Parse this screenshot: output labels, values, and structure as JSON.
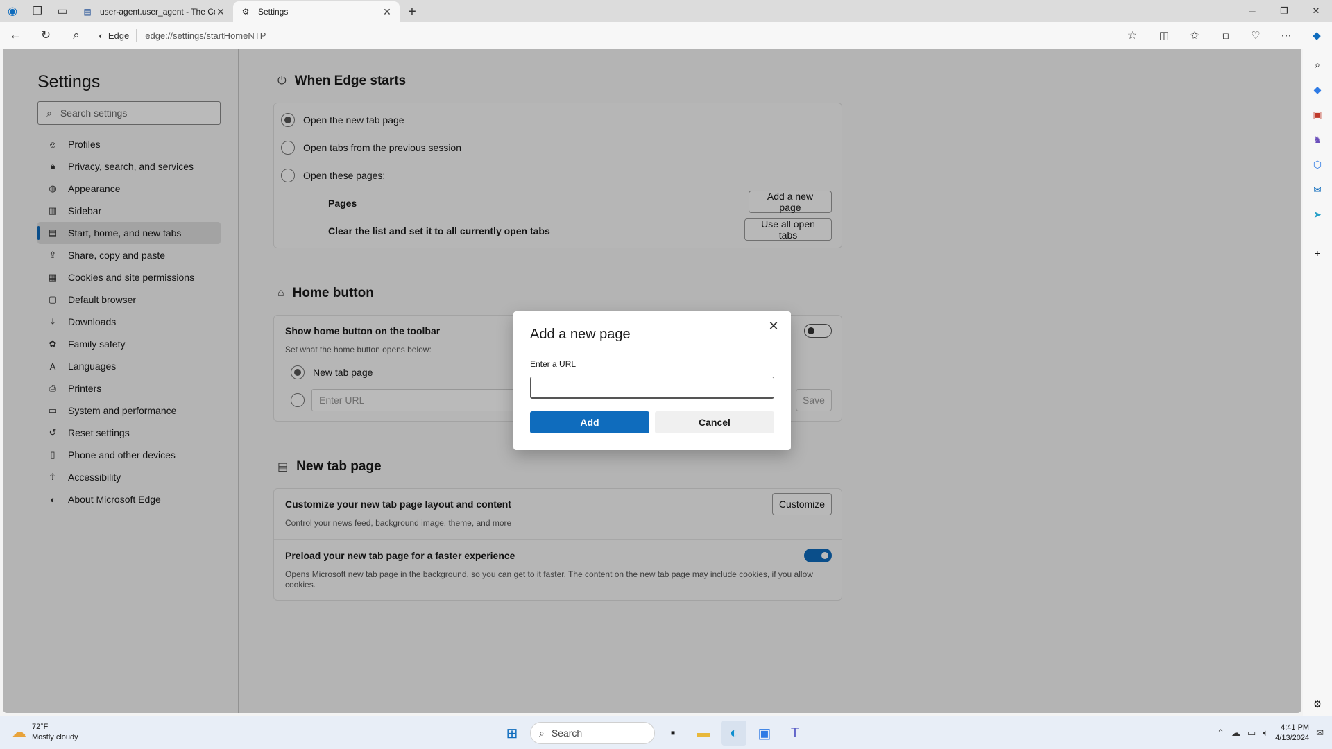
{
  "browser": {
    "tabs": [
      {
        "title": "user-agent.user_agent - The Coll",
        "active": false
      },
      {
        "title": "Settings",
        "active": true
      }
    ],
    "address": {
      "site_label": "Edge",
      "url": "edge://settings/startHomeNTP"
    }
  },
  "sidebar": {
    "title": "Settings",
    "search_placeholder": "Search settings",
    "items": [
      {
        "label": "Profiles",
        "icon": "person-icon"
      },
      {
        "label": "Privacy, search, and services",
        "icon": "lock-icon"
      },
      {
        "label": "Appearance",
        "icon": "palette-icon"
      },
      {
        "label": "Sidebar",
        "icon": "sidebar-icon"
      },
      {
        "label": "Start, home, and new tabs",
        "icon": "home-tabs-icon",
        "selected": true
      },
      {
        "label": "Share, copy and paste",
        "icon": "share-icon"
      },
      {
        "label": "Cookies and site permissions",
        "icon": "cookie-icon"
      },
      {
        "label": "Default browser",
        "icon": "browser-icon"
      },
      {
        "label": "Downloads",
        "icon": "download-icon"
      },
      {
        "label": "Family safety",
        "icon": "family-icon"
      },
      {
        "label": "Languages",
        "icon": "language-icon"
      },
      {
        "label": "Printers",
        "icon": "printer-icon"
      },
      {
        "label": "System and performance",
        "icon": "system-icon"
      },
      {
        "label": "Reset settings",
        "icon": "reset-icon"
      },
      {
        "label": "Phone and other devices",
        "icon": "phone-icon"
      },
      {
        "label": "Accessibility",
        "icon": "accessibility-icon"
      },
      {
        "label": "About Microsoft Edge",
        "icon": "edge-icon"
      }
    ]
  },
  "when_edge_starts": {
    "heading": "When Edge starts",
    "options": [
      {
        "label": "Open the new tab page",
        "selected": true
      },
      {
        "label": "Open tabs from the previous session",
        "selected": false
      },
      {
        "label": "Open these pages:",
        "selected": false
      }
    ],
    "pages_label": "Pages",
    "add_page_button": "Add a new page",
    "clear_list_label": "Clear the list and set it to all currently open tabs",
    "use_all_tabs_button": "Use all open tabs"
  },
  "home_button": {
    "heading": "Home button",
    "toggle_label": "Show home button on the toolbar",
    "toggle_on": false,
    "sub": "Set what the home button opens below:",
    "option_new_tab": "New tab page",
    "url_placeholder": "Enter URL",
    "save_button": "Save"
  },
  "new_tab_page": {
    "heading": "New tab page",
    "customize_label": "Customize your new tab page layout and content",
    "customize_sub": "Control your news feed, background image, theme, and more",
    "customize_button": "Customize",
    "preload_label": "Preload your new tab page for a faster experience",
    "preload_sub": "Opens Microsoft new tab page in the background, so you can get to it faster. The content on the new tab page may include cookies, if you allow cookies.",
    "preload_on": true
  },
  "dialog": {
    "title": "Add a new page",
    "field_label": "Enter a URL",
    "field_value": "",
    "add_button": "Add",
    "cancel_button": "Cancel"
  },
  "taskbar": {
    "weather_temp": "72°F",
    "weather_desc": "Mostly cloudy",
    "search_label": "Search",
    "time": "4:41 PM",
    "date": "4/13/2024"
  },
  "colors": {
    "accent": "#0f6cbd",
    "overlay": "rgba(0,0,0,0.27)"
  }
}
